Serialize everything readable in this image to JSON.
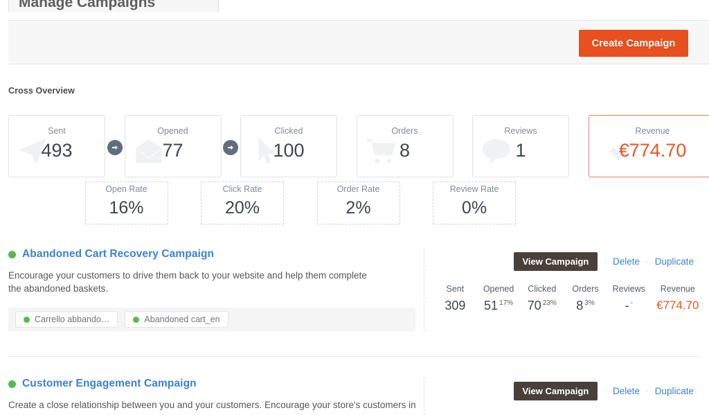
{
  "page": {
    "tab_title": "Manage Campaigns",
    "section_title": "Cross Overview"
  },
  "toolbar": {
    "create_label": "Create Campaign"
  },
  "colors": {
    "accent_orange": "#e8511f",
    "revenue_orange": "#ea5724",
    "link_blue": "#3b82d6",
    "status_green": "#56b94f",
    "arrow_slate": "#5e6e7d",
    "view_btn_dark": "#4a403a"
  },
  "funnel": {
    "cards": [
      {
        "label": "Sent",
        "value": "493",
        "icon": "paper-plane-icon",
        "highlight": false,
        "arrow_after": true
      },
      {
        "label": "Opened",
        "value": "77",
        "icon": "envelope-open-icon",
        "highlight": false,
        "arrow_after": true
      },
      {
        "label": "Clicked",
        "value": "100",
        "icon": "cursor-arrow-icon",
        "highlight": false,
        "arrow_after": false
      },
      {
        "label": "Orders",
        "value": "8",
        "icon": "shopping-cart-icon",
        "highlight": false,
        "arrow_after": false
      },
      {
        "label": "Reviews",
        "value": "1",
        "icon": "speech-bubble-icon",
        "highlight": false,
        "arrow_after": false
      },
      {
        "label": "Revenue",
        "value": "€774.70",
        "icon": "checkmark-icon",
        "highlight": true,
        "arrow_after": false
      }
    ],
    "rates": [
      {
        "label": "Open Rate",
        "value": "16%"
      },
      {
        "label": "Click Rate",
        "value": "20%"
      },
      {
        "label": "Order Rate",
        "value": "2%"
      },
      {
        "label": "Review Rate",
        "value": "0%"
      }
    ]
  },
  "actions": {
    "view_label": "View Campaign",
    "delete_label": "Delete",
    "duplicate_label": "Duplicate",
    "separator": "·"
  },
  "stats_headers": [
    "Sent",
    "Opened",
    "Clicked",
    "Orders",
    "Reviews",
    "Revenue"
  ],
  "campaigns": [
    {
      "title": "Abandoned Cart Recovery Campaign",
      "description": "Encourage your customers to drive them back to your website and help them complete the abandoned baskets.",
      "tags": [
        "Carrello abbando…",
        "Abandoned cart_en"
      ],
      "stats": {
        "sent": {
          "value": "309",
          "pct": ""
        },
        "opened": {
          "value": "51",
          "pct": "17%"
        },
        "clicked": {
          "value": "70",
          "pct": "23%"
        },
        "orders": {
          "value": "8",
          "pct": "3%"
        },
        "reviews": {
          "value": "-",
          "pct": "-"
        },
        "revenue": {
          "value": "€774.70",
          "pct": ""
        }
      }
    },
    {
      "title": "Customer Engagement Campaign",
      "description": "Create a close relationship between you and your customers. Encourage your store's customers in"
    }
  ]
}
